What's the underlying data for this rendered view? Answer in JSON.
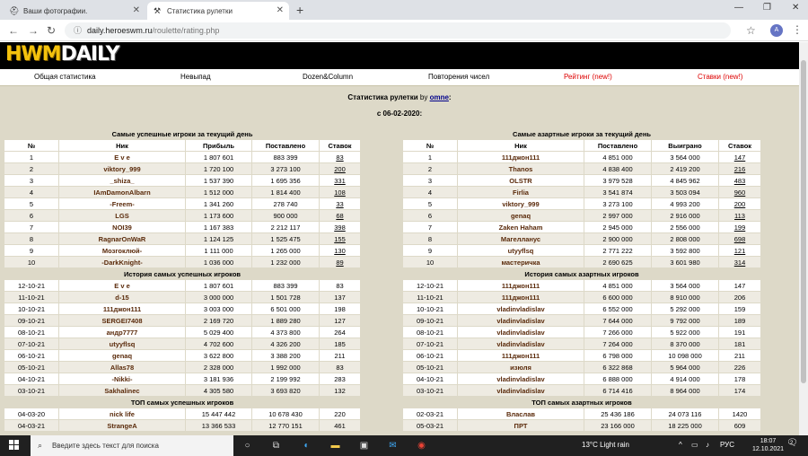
{
  "browser": {
    "tabs": [
      {
        "title": "Ваши фотографии.",
        "icon": "helmet-icon"
      },
      {
        "title": "Статистика рулетки",
        "icon": "tools-icon"
      }
    ],
    "url_host": "daily.heroeswm.ru",
    "url_path": "/roulette/rating.php",
    "avatar": "A"
  },
  "site": {
    "logo_left": "HWM",
    "logo_right": "DAILY",
    "menu": [
      "Общая статистика",
      "Невыпад",
      "Dozen&Column",
      "Повторения чисел",
      "Рейтинг (new!)",
      "Ставки (new!)"
    ],
    "title_prefix": "Статистика рулетки",
    "title_by": "by",
    "title_author": "omne",
    "title_colon": ":",
    "date_line": "с 06-02-2020:"
  },
  "left_table": {
    "section1": "Самые успешные игроки за текущий день",
    "headers1": [
      "№",
      "Ник",
      "Прибыль",
      "Поставлено",
      "Ставок"
    ],
    "rows1": [
      [
        "1",
        "E v e",
        "1 807 601",
        "883 399",
        "83"
      ],
      [
        "2",
        "viktory_999",
        "1 720 100",
        "3 273 100",
        "200"
      ],
      [
        "3",
        "_shiza_",
        "1 537 390",
        "1 695 356",
        "331"
      ],
      [
        "4",
        "IAmDamonAlbarn",
        "1 512 000",
        "1 814 400",
        "108"
      ],
      [
        "5",
        "-Freem-",
        "1 341 260",
        "278 740",
        "33"
      ],
      [
        "6",
        "LGS",
        "1 173 600",
        "900 000",
        "68"
      ],
      [
        "7",
        "NOI39",
        "1 167 383",
        "2 212 117",
        "398"
      ],
      [
        "8",
        "RagnarOnWaR",
        "1 124 125",
        "1 525 475",
        "155"
      ],
      [
        "9",
        "Мозгоклюй-",
        "1 111 000",
        "1 265 000",
        "130"
      ],
      [
        "10",
        "-DarkKnight-",
        "1 036 000",
        "1 232 000",
        "89"
      ]
    ],
    "section2": "История самых успешных игроков",
    "rows2": [
      [
        "12-10-21",
        "E v e",
        "1 807 601",
        "883 399",
        "83"
      ],
      [
        "11-10-21",
        "d-15",
        "3 000 000",
        "1 501 728",
        "137"
      ],
      [
        "10-10-21",
        "111джон111",
        "3 003 000",
        "6 501 000",
        "198"
      ],
      [
        "09-10-21",
        "SERGEI7408",
        "2 169 720",
        "1 889 280",
        "127"
      ],
      [
        "08-10-21",
        "андр7777",
        "5 029 400",
        "4 373 800",
        "264"
      ],
      [
        "07-10-21",
        "utyyflsq",
        "4 702 600",
        "4 326 200",
        "185"
      ],
      [
        "06-10-21",
        "genaq",
        "3 622 800",
        "3 388 200",
        "211"
      ],
      [
        "05-10-21",
        "Allas78",
        "2 328 000",
        "1 992 000",
        "83"
      ],
      [
        "04-10-21",
        "-Nikki-",
        "3 181 936",
        "2 199 992",
        "283"
      ],
      [
        "03-10-21",
        "Sakhalinec",
        "4 305 580",
        "3 693 820",
        "132"
      ]
    ],
    "section3": "ТОП самых успешных игроков",
    "rows3": [
      [
        "04-03-20",
        "nick life",
        "15 447 442",
        "10 678 430",
        "220"
      ],
      [
        "04-03-21",
        "StrangeA",
        "13 366 533",
        "12 770 151",
        "461"
      ]
    ]
  },
  "right_table": {
    "section1": "Самые азартные игроки за текущий день",
    "headers1": [
      "№",
      "Ник",
      "Поставлено",
      "Выиграно",
      "Ставок"
    ],
    "rows1": [
      [
        "1",
        "111джон111",
        "4 851 000",
        "3 564 000",
        "147"
      ],
      [
        "2",
        "Thanos",
        "4 838 400",
        "2 419 200",
        "216"
      ],
      [
        "3",
        "OLSTR",
        "3 979 528",
        "4 845 962",
        "483"
      ],
      [
        "4",
        "Firlia",
        "3 541 874",
        "3 503 094",
        "960"
      ],
      [
        "5",
        "viktory_999",
        "3 273 100",
        "4 993 200",
        "200"
      ],
      [
        "6",
        "genaq",
        "2 997 000",
        "2 916 000",
        "113"
      ],
      [
        "7",
        "Zaken Haham",
        "2 945 000",
        "2 556 000",
        "199"
      ],
      [
        "8",
        "Магелланус",
        "2 900 000",
        "2 808 000",
        "698"
      ],
      [
        "9",
        "utyyflsq",
        "2 771 222",
        "3 592 800",
        "121"
      ],
      [
        "10",
        "мастеричка",
        "2 690 625",
        "3 601 980",
        "314"
      ]
    ],
    "section2": "История самых азартных игроков",
    "rows2": [
      [
        "12-10-21",
        "111джон111",
        "4 851 000",
        "3 564 000",
        "147"
      ],
      [
        "11-10-21",
        "111джон111",
        "6 600 000",
        "8 910 000",
        "206"
      ],
      [
        "10-10-21",
        "vladinvladislav",
        "6 552 000",
        "5 292 000",
        "159"
      ],
      [
        "09-10-21",
        "vladinvladislav",
        "7 644 000",
        "9 792 000",
        "189"
      ],
      [
        "08-10-21",
        "vladinvladislav",
        "7 266 000",
        "5 922 000",
        "191"
      ],
      [
        "07-10-21",
        "vladinvladislav",
        "7 264 000",
        "8 370 000",
        "181"
      ],
      [
        "06-10-21",
        "111джон111",
        "6 798 000",
        "10 098 000",
        "211"
      ],
      [
        "05-10-21",
        "изюля",
        "6 322 868",
        "5 964 000",
        "226"
      ],
      [
        "04-10-21",
        "vladinvladislav",
        "6 888 000",
        "4 914 000",
        "178"
      ],
      [
        "03-10-21",
        "vladinvladislav",
        "6 714 416",
        "8 964 000",
        "174"
      ]
    ],
    "section3": "ТОП самых азартных игроков",
    "rows3": [
      [
        "02-03-21",
        "Власлав",
        "25 436 186",
        "24 073 116",
        "1420"
      ],
      [
        "05-03-21",
        "ПРТ",
        "23 166 000",
        "18 225 000",
        "609"
      ]
    ]
  },
  "taskbar": {
    "search_placeholder": "Введите здесь текст для поиска",
    "weather": "13°C  Light rain",
    "lang": "РУС",
    "time": "18:07",
    "date": "12.10.2021",
    "notif": "2"
  }
}
